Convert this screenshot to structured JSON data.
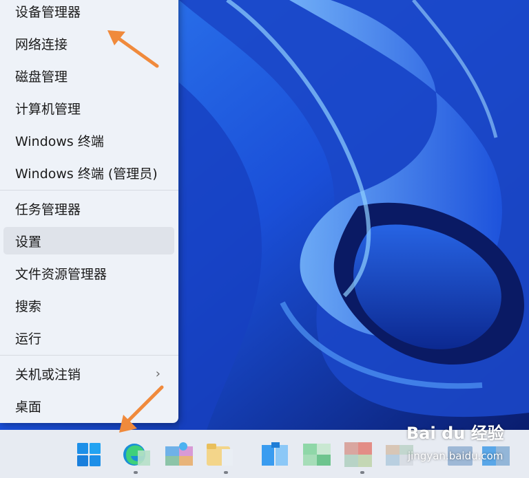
{
  "context_menu": {
    "groups": [
      [
        "设备管理器",
        "网络连接",
        "磁盘管理",
        "计算机管理",
        "Windows 终端",
        "Windows 终端 (管理员)"
      ],
      [
        "任务管理器",
        "设置",
        "文件资源管理器",
        "搜索",
        "运行"
      ],
      [
        "关机或注销",
        "桌面"
      ]
    ],
    "items": {
      "device_manager": "设备管理器",
      "network_connections": "网络连接",
      "disk_management": "磁盘管理",
      "computer_management": "计算机管理",
      "terminal": "Windows 终端",
      "terminal_admin": "Windows 终端 (管理员)",
      "task_manager": "任务管理器",
      "settings": "设置",
      "file_explorer": "文件资源管理器",
      "search": "搜索",
      "run": "运行",
      "shutdown": "关机或注销",
      "desktop": "桌面"
    },
    "highlighted_item": "设置",
    "submenu_indicator": "›"
  },
  "taskbar": {
    "icons": [
      "windows-start-icon",
      "edge-icon",
      "app-icon",
      "folder-icon",
      "store-icon",
      "app-icon",
      "app-icon",
      "app-icon",
      "app-icon"
    ]
  },
  "annotations": {
    "arrow_color": "#f08a3c",
    "targets": [
      "device-manager",
      "start-button"
    ]
  },
  "watermark": {
    "brand": "Bai du 经验",
    "site": "jingyan.baidu.com"
  },
  "colors": {
    "wallpaper_dark": "#0a2278",
    "wallpaper_light": "#4a9cff",
    "menu_bg": "#eef2f8",
    "highlight": "#dfe3ea",
    "taskbar_bg": "#e7ebf2"
  }
}
